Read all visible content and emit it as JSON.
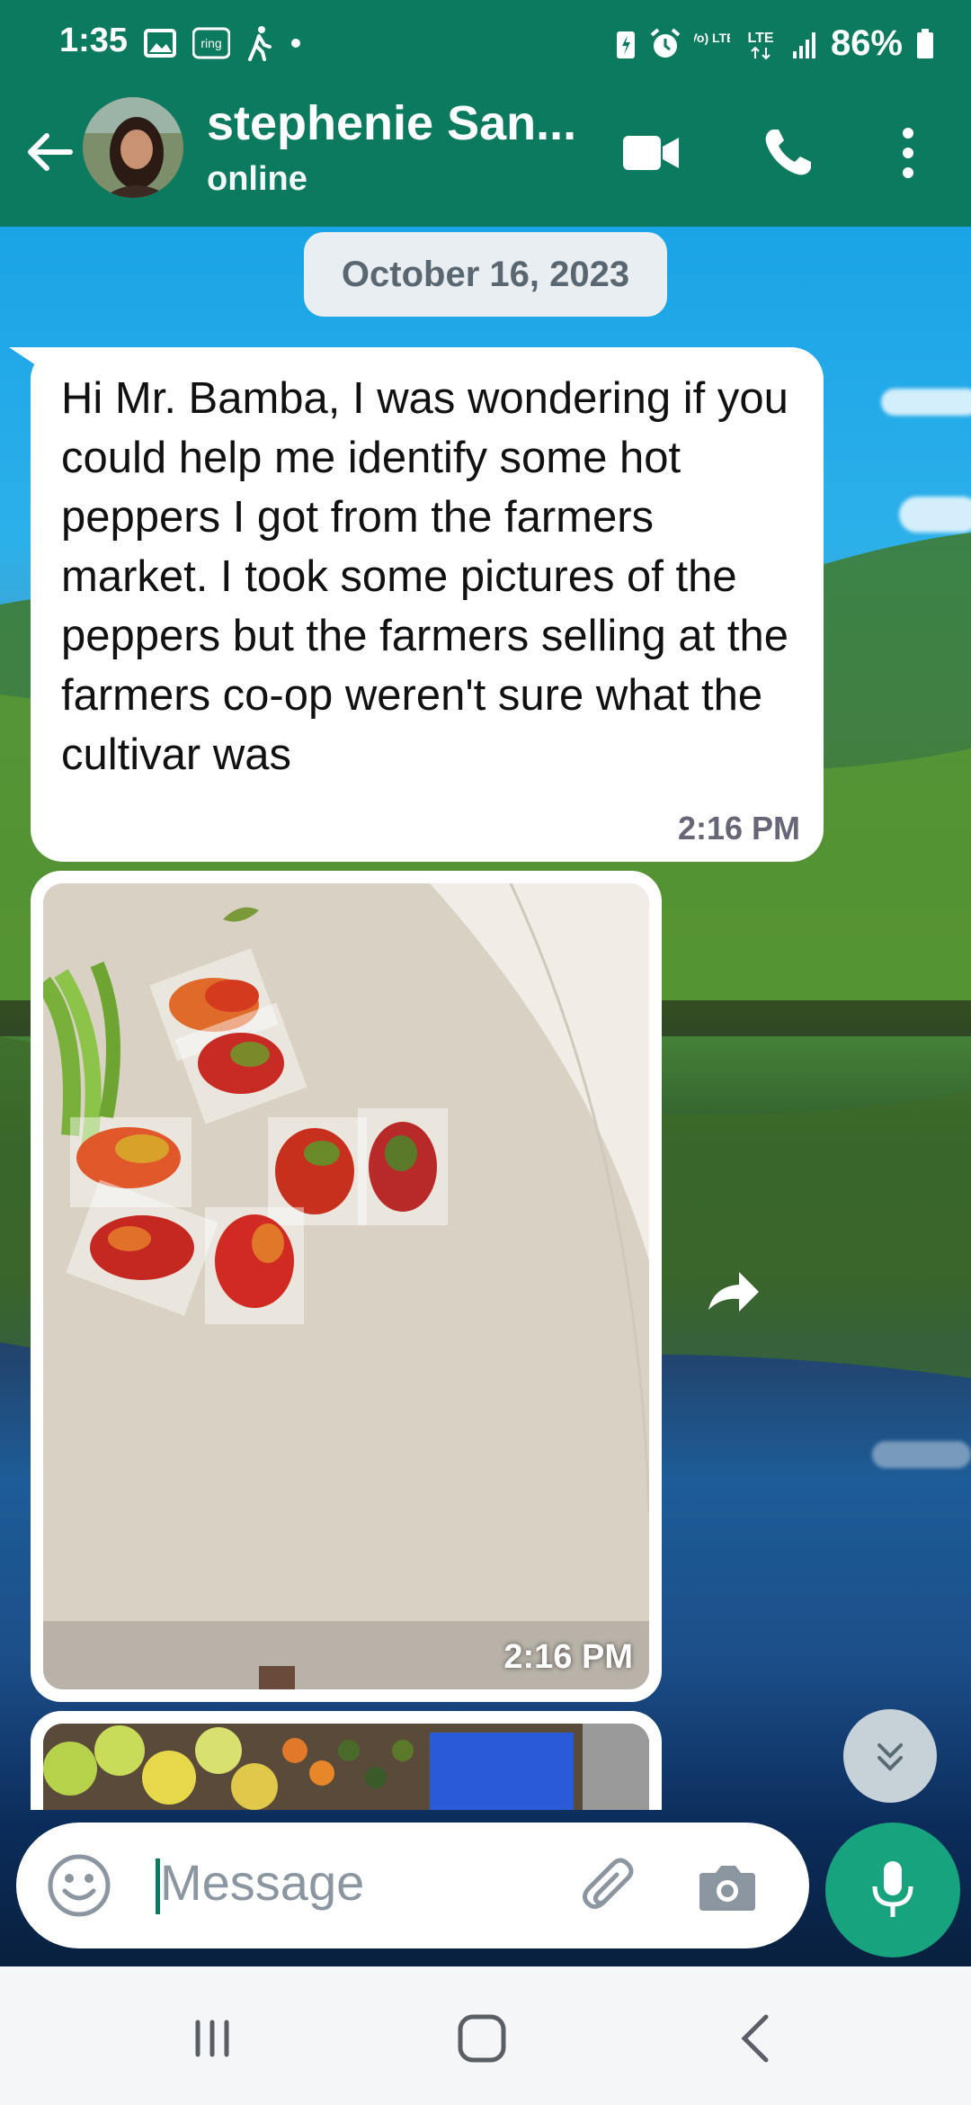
{
  "status_bar": {
    "time": "1:35",
    "battery": "86%",
    "left_icons": [
      "gallery-icon",
      "ring-icon",
      "walking-icon",
      "dot-icon"
    ],
    "right_icons": [
      "battery-saver-icon",
      "alarm-icon",
      "volte-icon",
      "lte-icon",
      "signal-icon",
      "battery-icon"
    ],
    "ring_label": "ring",
    "volte_label": "Vo) LTE",
    "lte_label": "LTE"
  },
  "header": {
    "contact_name": "stephenie San...",
    "status": "online",
    "accent": "#0b7a5e"
  },
  "chat": {
    "date_chip": "October 16, 2023",
    "messages": [
      {
        "type": "text",
        "text": "Hi Mr. Bamba, I was wondering if you could help me identify some hot peppers I got from the farmers market. I took some pictures of the peppers but the farmers selling at the farmers co-op weren't sure what the cultivar was",
        "time": "2:16 PM"
      },
      {
        "type": "image",
        "description_icon": "photo-peppers",
        "time": "2:16 PM"
      },
      {
        "type": "image",
        "description_icon": "photo-fruits"
      }
    ]
  },
  "input": {
    "placeholder": "Message"
  },
  "colors": {
    "mic_button": "#17a37e",
    "header_bg": "#0b7a5e"
  }
}
